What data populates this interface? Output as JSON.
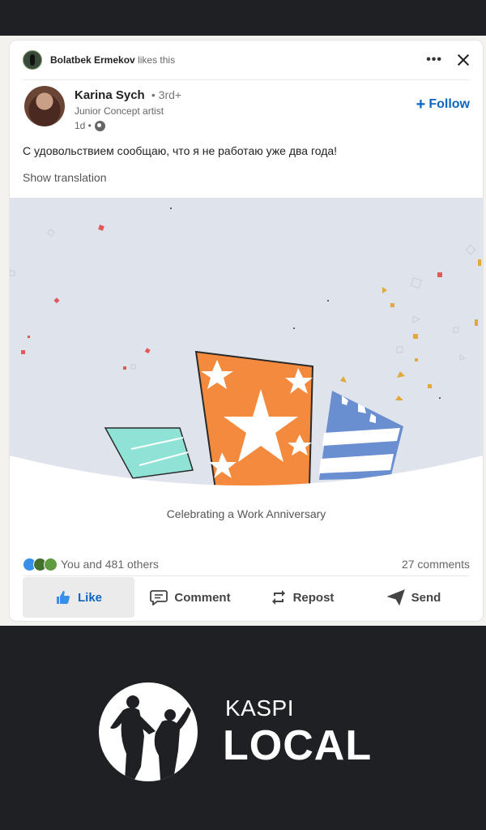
{
  "social": {
    "actor_name": "Bolatbek Ermekov",
    "action_text": "likes this"
  },
  "author": {
    "name": "Karina Sych",
    "degree": "• 3rd+",
    "headline": "Junior Concept artist",
    "time": "1d •"
  },
  "follow_label": "Follow",
  "post": {
    "text": "С удовольствием сообщаю, что я не работаю уже два года!",
    "show_translation": "Show translation"
  },
  "celebration": {
    "caption": "Celebrating a Work Anniversary"
  },
  "reactions": {
    "summary": "You and 481 others",
    "comments": "27 comments"
  },
  "actions": {
    "like": "Like",
    "comment": "Comment",
    "repost": "Repost",
    "send": "Send"
  },
  "branding": {
    "line1": "KASPI",
    "line2": "LOCAL"
  },
  "colors": {
    "accent": "#0a66c2",
    "card_background": "#ffffff",
    "page_background": "#1f2023",
    "celebration_background": "#dfe4ec"
  }
}
